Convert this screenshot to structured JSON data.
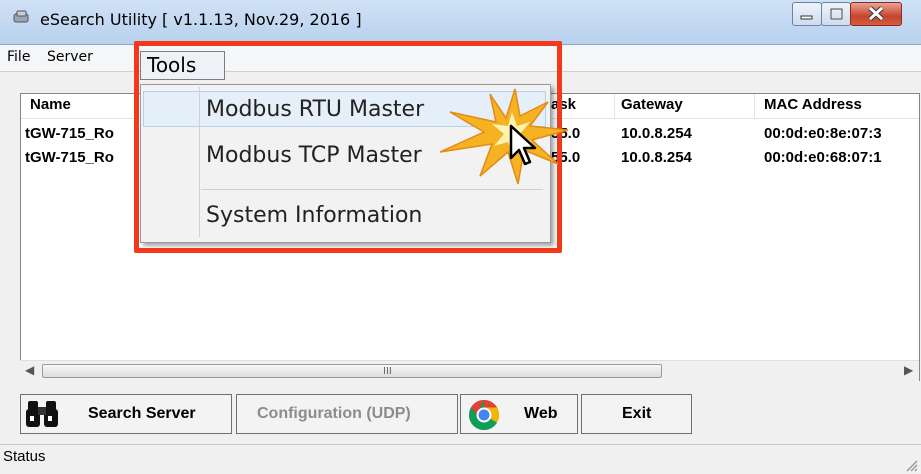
{
  "window": {
    "title": "eSearch Utility [ v1.1.13, Nov.29, 2016 ]",
    "controls": {
      "minimize": "minimize-icon",
      "maximize": "maximize-icon",
      "close": "close-icon"
    }
  },
  "menubar": {
    "file": "File",
    "server": "Server",
    "tools": "Tools"
  },
  "tools_menu": {
    "items": [
      "Modbus RTU Master",
      "Modbus TCP Master",
      "System Information"
    ],
    "highlighted": "Modbus RTU Master"
  },
  "table": {
    "columns": [
      "Name",
      "ask",
      "Gateway",
      "MAC Address"
    ],
    "rows": [
      {
        "name": "tGW-715_Ro",
        "mask": "55.0",
        "gateway": "10.0.8.254",
        "mac": "00:0d:e0:8e:07:3"
      },
      {
        "name": "tGW-715_Ro",
        "mask": "55.0",
        "gateway": "10.0.8.254",
        "mac": "00:0d:e0:68:07:1"
      }
    ],
    "scroll_grip": "III"
  },
  "buttons": {
    "search": "Search Server",
    "config": "Configuration (UDP)",
    "web": "Web",
    "exit": "Exit"
  },
  "status": {
    "text": "Status"
  },
  "colors": {
    "highlight_border": "#f2391a",
    "burst": "#f5b324"
  },
  "icons": [
    "app-icon",
    "binoculars-icon",
    "chrome-icon",
    "cursor-icon",
    "starburst-icon"
  ]
}
